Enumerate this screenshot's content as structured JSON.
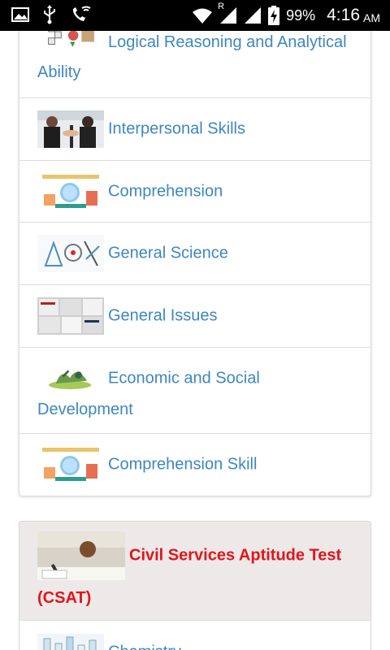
{
  "status_bar": {
    "battery": "99%",
    "time": "4:16",
    "ampm": "AM",
    "roaming": "R"
  },
  "topics": [
    {
      "label": "Logical Reasoning and Analytical Ability",
      "icon": "logic-puzzle-icon"
    },
    {
      "label": "Interpersonal Skills",
      "icon": "handshake-photo-icon"
    },
    {
      "label": "Comprehension",
      "icon": "reading-comprehension-icon"
    },
    {
      "label": "General Science",
      "icon": "science-collage-icon"
    },
    {
      "label": "General Issues",
      "icon": "newspapers-icon"
    },
    {
      "label": "Economic and Social Development",
      "icon": "green-growth-icon"
    },
    {
      "label": "Comprehension Skill",
      "icon": "reading-comprehension-icon"
    }
  ],
  "section": {
    "title": "Civil Services Aptitude Test (CSAT)",
    "icon": "student-writing-photo-icon"
  },
  "next_item": {
    "label": "Chemistry",
    "icon": "lab-glassware-icon"
  },
  "colors": {
    "link": "#3d87c0",
    "heading": "#e3141b",
    "heading_bg": "#eee9e9"
  }
}
